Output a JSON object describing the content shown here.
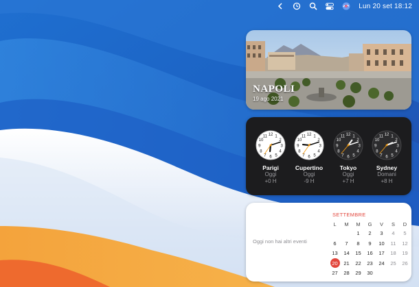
{
  "menubar": {
    "icons": [
      "chevron-left-icon",
      "time-machine-icon",
      "search-icon",
      "control-center-icon",
      "siri-icon"
    ],
    "clock": "Lun 20 set  18:12"
  },
  "photo_widget": {
    "title": "NAPOLI",
    "date": "19 ago 2021"
  },
  "clock_widget": {
    "clocks": [
      {
        "city": "Parigi",
        "day": "Oggi",
        "offset": "+0 H",
        "hour": 18,
        "minute": 12,
        "theme": "light"
      },
      {
        "city": "Cupertino",
        "day": "Oggi",
        "offset": "-9 H",
        "hour": 9,
        "minute": 12,
        "theme": "light"
      },
      {
        "city": "Tokyo",
        "day": "Oggi",
        "offset": "+7 H",
        "hour": 1,
        "minute": 12,
        "theme": "dark"
      },
      {
        "city": "Sydney",
        "day": "Domani",
        "offset": "+8 H",
        "hour": 2,
        "minute": 12,
        "theme": "dark"
      }
    ]
  },
  "calendar_widget": {
    "no_events": "Oggi non hai altri eventi",
    "month": "SETTEMBRE",
    "weekdays": [
      "L",
      "M",
      "M",
      "G",
      "V",
      "S",
      "D"
    ],
    "weeks": [
      [
        "",
        "",
        "1",
        "2",
        "3",
        "4",
        "5"
      ],
      [
        "6",
        "7",
        "8",
        "9",
        "10",
        "11",
        "12"
      ],
      [
        "13",
        "14",
        "15",
        "16",
        "17",
        "18",
        "19"
      ],
      [
        "20",
        "21",
        "22",
        "23",
        "24",
        "25",
        "26"
      ],
      [
        "27",
        "28",
        "29",
        "30",
        "",
        "",
        ""
      ]
    ],
    "today": "20",
    "accent_color": "#e2453b"
  }
}
